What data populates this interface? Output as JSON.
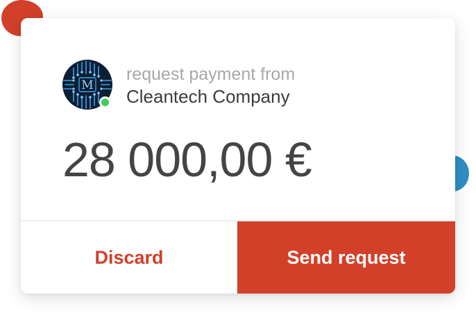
{
  "payment_request": {
    "from_label": "request payment from",
    "company_name": "Cleantech Company",
    "amount": "28 000,00 €",
    "company_avatar": {
      "initial": "M",
      "online": true
    }
  },
  "actions": {
    "discard_label": "Discard",
    "send_label": "Send request"
  },
  "colors": {
    "accent": "#D2402A",
    "online": "#3DCC5A",
    "decor_blue": "#2E8FC4",
    "avatar_bg": "#0E1E33",
    "avatar_circuit": "#3AA3E8"
  }
}
